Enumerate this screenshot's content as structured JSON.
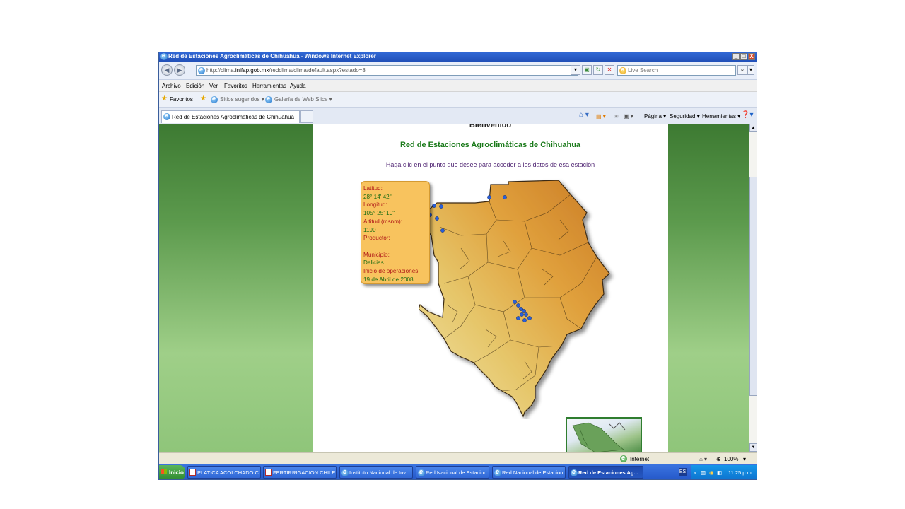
{
  "window": {
    "title": "Red de Estaciones Agroclimáticas de Chihuahua - Windows Internet Explorer",
    "buttons": [
      "_",
      "□",
      "X"
    ]
  },
  "address_bar": {
    "url_prefix": "http://clima.",
    "url_host": "inifap.gob.mx",
    "url_path": "/redclima/clima/default.aspx?estado=8",
    "search_placeholder": "Live Search"
  },
  "menu": [
    "Archivo",
    "Edición",
    "Ver",
    "Favoritos",
    "Herramientas",
    "Ayuda"
  ],
  "favorites_bar": {
    "favorites_label": "Favoritos",
    "suggested_sites": "Sitios sugeridos ▾",
    "web_slice": "Galería de Web Slice ▾"
  },
  "tab": {
    "label": "Red de Estaciones Agroclimáticas de Chihuahua"
  },
  "command_bar": [
    "Página ▾",
    "Seguridad ▾",
    "Herramientas ▾"
  ],
  "page": {
    "welcome": "Bienvenido",
    "title": "Red de Estaciones Agroclimáticas de Chihuahua",
    "instruction": "Haga clic en el punto que desee para acceder a los datos de esa estación",
    "info": {
      "lat_label": "Latitud:",
      "lat_value": "28° 14' 42\"",
      "lon_label": "Longitud:",
      "lon_value": "105° 25' 10\"",
      "alt_label": "Altitud (msnm):",
      "alt_value": "1190",
      "prod_label": "Productor:",
      "mun_label": "Municipio:",
      "mun_value": "Delicias",
      "start_label": "Inicio de operaciones:",
      "start_value": "19 de Abril de 2008"
    }
  },
  "status_bar": {
    "zone": "Internet",
    "zoom": "100%"
  },
  "taskbar": {
    "start": "Inicio",
    "tasks": [
      "PLATICA ACOLCHADO C...",
      "FERTIRRIGACION  CHILE",
      "Instituto Nacional de Inv...",
      "Red Nacional de Estacion...",
      "Red Nacional de Estacion...",
      "Red de Estaciones Ag..."
    ],
    "lang": "ES",
    "clock": "11:25 p.m."
  },
  "colors": {
    "title_green": "#1a7a1a",
    "instruction_purple": "#4b1f6f",
    "info_box": "#f8c35e",
    "station_dot": "#2a5fd8"
  }
}
